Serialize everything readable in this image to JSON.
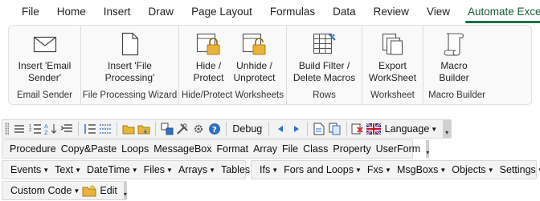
{
  "tabs": [
    {
      "label": "File"
    },
    {
      "label": "Home"
    },
    {
      "label": "Insert"
    },
    {
      "label": "Draw"
    },
    {
      "label": "Page Layout"
    },
    {
      "label": "Formulas"
    },
    {
      "label": "Data"
    },
    {
      "label": "Review"
    },
    {
      "label": "View"
    },
    {
      "label": "Automate Excel"
    }
  ],
  "ribbon": {
    "groups": [
      {
        "title": "Email Sender",
        "buttons": [
          {
            "label": "Insert 'Email\nSender'",
            "icon": "envelope-icon"
          }
        ]
      },
      {
        "title": "File Processing Wizard",
        "buttons": [
          {
            "label": "Insert 'File\nProcessing'",
            "icon": "document-icon"
          }
        ]
      },
      {
        "title": "Hide/Protect Worksheets",
        "buttons": [
          {
            "label": "Hide /\nProtect",
            "icon": "lock-icon"
          },
          {
            "label": "Unhide /\nUnprotect",
            "icon": "unlock-icon"
          }
        ]
      },
      {
        "title": "Rows",
        "buttons": [
          {
            "label": "Build Filter /\nDelete Macros",
            "icon": "filter-grid-icon"
          }
        ]
      },
      {
        "title": "Worksheet",
        "buttons": [
          {
            "label": "Export\nWorkSheet",
            "icon": "export-sheets-icon"
          }
        ]
      },
      {
        "title": "Macro Builder",
        "buttons": [
          {
            "label": "Macro\nBuilder",
            "icon": "scroll-icon"
          }
        ]
      }
    ]
  },
  "toolbar1": {
    "debug": "Debug",
    "language": "Language"
  },
  "toolbar2": {
    "items": [
      "Procedure",
      "Copy&Paste",
      "Loops",
      "MessageBox",
      "Format",
      "Array",
      "File",
      "Class",
      "Property",
      "UserForm"
    ]
  },
  "toolbar3": {
    "left": [
      "Events",
      "Text",
      "DateTime",
      "Files",
      "Arrays",
      "Tables"
    ],
    "right": [
      "Ifs",
      "Fors and Loops",
      "Fxs",
      "MsgBoxs",
      "Objects",
      "Settings"
    ]
  },
  "toolbar4": {
    "custom_code": "Custom Code",
    "edit": "Edit"
  },
  "colors": {
    "accent": "#1e7145",
    "folder": "#e8b53a",
    "blue_icon": "#2f6fc4"
  }
}
